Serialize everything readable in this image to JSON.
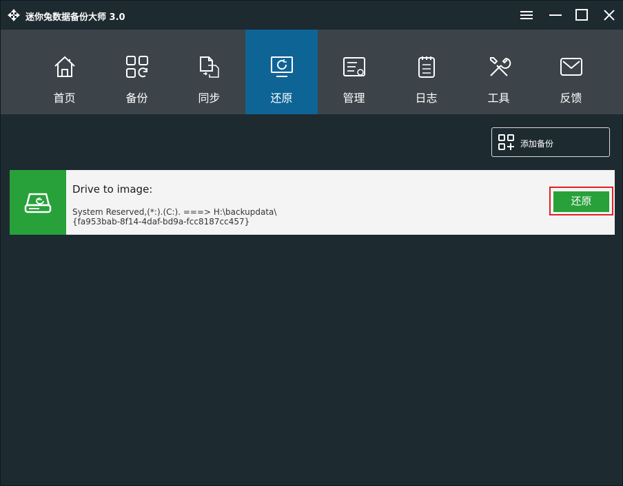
{
  "app": {
    "title": "迷你兔数据备份大师 3.0"
  },
  "titlebar": {
    "icons": [
      "app-logo-icon",
      "menu-icon",
      "minimize-icon",
      "maximize-icon",
      "close-icon"
    ]
  },
  "nav": {
    "items": [
      {
        "label": "首页",
        "icon": "home-icon",
        "active": false
      },
      {
        "label": "备份",
        "icon": "backup-icon",
        "active": false
      },
      {
        "label": "同步",
        "icon": "sync-icon",
        "active": false
      },
      {
        "label": "还原",
        "icon": "restore-icon",
        "active": true
      },
      {
        "label": "管理",
        "icon": "manage-icon",
        "active": false
      },
      {
        "label": "日志",
        "icon": "log-icon",
        "active": false
      },
      {
        "label": "工具",
        "icon": "tools-icon",
        "active": false
      },
      {
        "label": "反馈",
        "icon": "feedback-icon",
        "active": false
      }
    ]
  },
  "toolbar": {
    "add_backup_label": "添加备份",
    "add_backup_icon": "add-backup-icon"
  },
  "task": {
    "title": "Drive to image:",
    "source": "System Reserved,(*:).(C:). ===> H:\\backupdata\\",
    "id": "{fa953bab-8f14-4daf-bd9a-fcc8187cc457}",
    "icon": "drive-icon",
    "restore_label": "还原"
  },
  "colors": {
    "window_bg": "#1d2a30",
    "nav_bg": "#3c4449",
    "nav_active": "#0f6496",
    "accent_green": "#28a13a",
    "highlight_red": "#e02020",
    "card_bg": "#f4f4f4"
  }
}
